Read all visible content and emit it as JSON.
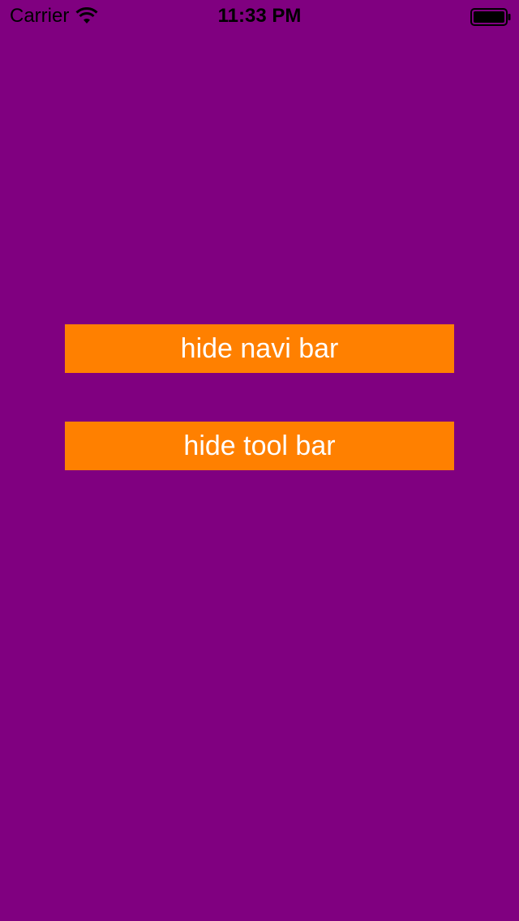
{
  "status_bar": {
    "carrier": "Carrier",
    "time": "11:33 PM",
    "icons": [
      "wifi-icon",
      "battery-icon"
    ]
  },
  "buttons": {
    "hide_navi_bar": "hide navi bar",
    "hide_tool_bar": "hide tool bar"
  },
  "colors": {
    "background": "#800080",
    "button": "#FF8000",
    "button_text": "#FFFFFF"
  }
}
